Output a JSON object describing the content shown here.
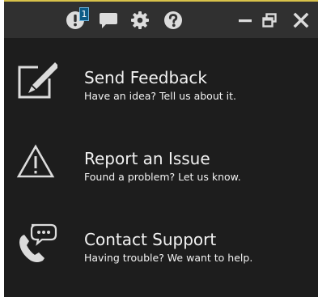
{
  "titlebar": {
    "notifications_count": "1",
    "buttons": [
      {
        "icon": "notifications-icon"
      },
      {
        "icon": "chat-icon"
      },
      {
        "icon": "gear-icon"
      },
      {
        "icon": "help-icon"
      },
      {
        "icon": "minimize-icon"
      },
      {
        "icon": "restore-icon"
      },
      {
        "icon": "close-icon"
      }
    ]
  },
  "menu": {
    "items": [
      {
        "icon": "edit-icon",
        "title": "Send Feedback",
        "subtitle": "Have an idea? Tell us about it."
      },
      {
        "icon": "warning-icon",
        "title": "Report an Issue",
        "subtitle": "Found a problem? Let us know."
      },
      {
        "icon": "phone-chat-icon",
        "title": "Contact Support",
        "subtitle": "Having trouble? We want to help."
      }
    ]
  },
  "colors": {
    "background": "#1d1d1d",
    "titlebar": "#303030",
    "titlebar_accent": "#d8c24a",
    "icon": "#dcdcdc",
    "text": "#f2f2f2",
    "badge": "#0c5b86"
  }
}
